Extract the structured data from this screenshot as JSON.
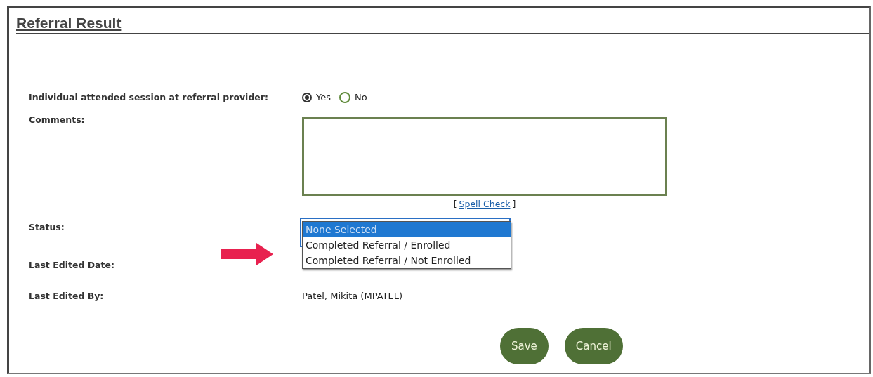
{
  "title": "Referral Result",
  "attended": {
    "label": "Individual attended session at referral provider:",
    "options": [
      {
        "label": "Yes",
        "selected": true
      },
      {
        "label": "No",
        "selected": false
      }
    ]
  },
  "comments": {
    "label": "Comments:",
    "spell_check": {
      "open": "[",
      "link": "Spell Check",
      "close": "]"
    }
  },
  "status": {
    "label": "Status:",
    "expanded": true,
    "options": [
      {
        "label": "None Selected",
        "selected": true
      },
      {
        "label": "Completed Referral / Enrolled",
        "selected": false
      },
      {
        "label": "Completed Referral / Not Enrolled",
        "selected": false
      }
    ]
  },
  "last_edited_date": {
    "label": "Last Edited Date:"
  },
  "last_edited_by": {
    "label": "Last Edited By:",
    "value": "Patel, Mikita (MPATEL)"
  },
  "buttons": [
    "Save",
    "Cancel"
  ]
}
